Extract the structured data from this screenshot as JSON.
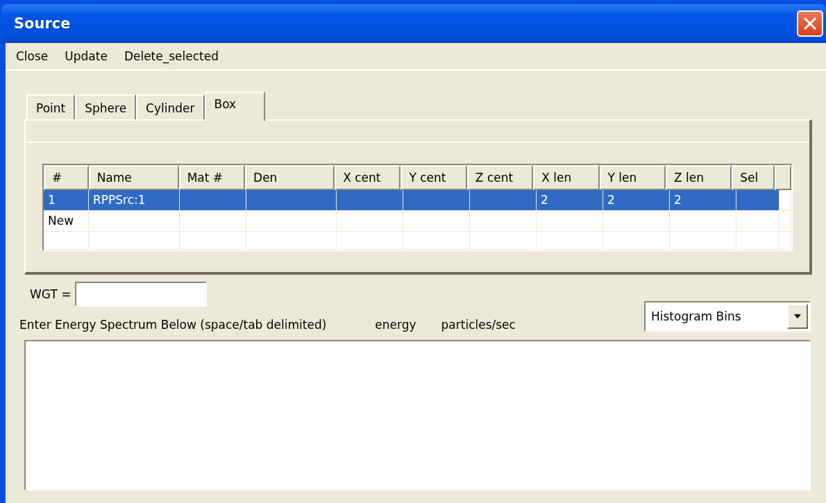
{
  "window": {
    "title": "Source"
  },
  "menu": [
    "Close",
    "Update",
    "Delete_selected"
  ],
  "tabs": [
    {
      "label": "Point",
      "selected": false
    },
    {
      "label": "Sphere",
      "selected": false
    },
    {
      "label": "Cylinder",
      "selected": false
    },
    {
      "label": "Box",
      "selected": true
    }
  ],
  "table": {
    "columns": [
      "#",
      "Name",
      "Mat #",
      "Den",
      "X cent",
      "Y cent",
      "Z cent",
      "X len",
      "Y len",
      "Z len",
      "Sel"
    ],
    "rows": [
      {
        "selected": true,
        "cells": [
          "1",
          "RPPSrc:1",
          null,
          null,
          null,
          null,
          null,
          "2",
          "2",
          "2",
          null
        ]
      },
      {
        "selected": false,
        "cells": [
          "New",
          null,
          null,
          null,
          null,
          null,
          null,
          null,
          null,
          null,
          null
        ]
      }
    ]
  },
  "wgt": {
    "label": "WGT ="
  },
  "spectrum": {
    "label": "Enter Energy Spectrum Below (space/tab delimited)",
    "column_1": "energy",
    "column_2": "particles/sec",
    "mode": "Histogram Bins"
  }
}
